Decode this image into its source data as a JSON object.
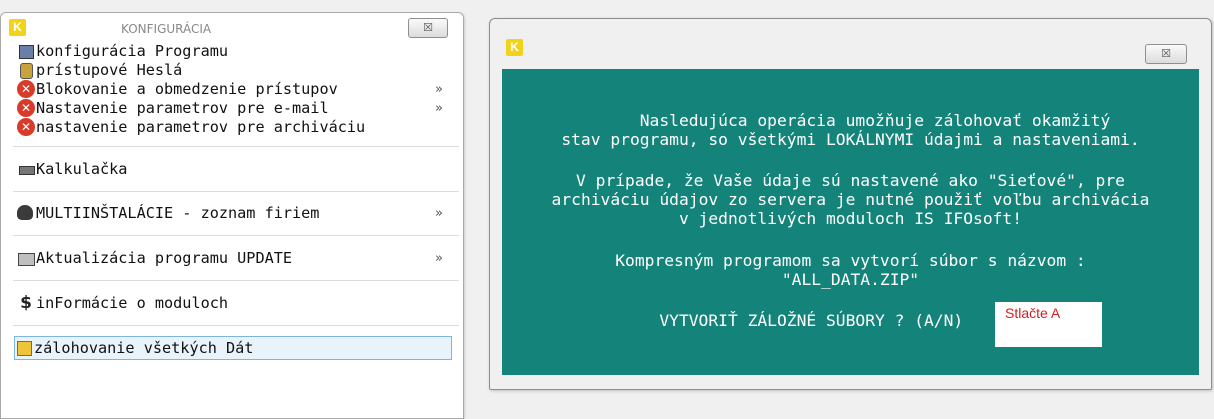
{
  "menu_window": {
    "logo": "K",
    "title": "KONFIGURÁCIA",
    "close_glyph": "☒",
    "items": [
      {
        "label": "konfigurácia Programu",
        "icon": "config-icon",
        "has_submenu": false,
        "enabled": true
      },
      {
        "label": "prístupové Heslá",
        "icon": "key-icon",
        "has_submenu": false,
        "enabled": true
      },
      {
        "label": "Blokovanie a obmedzenie prístupov",
        "icon": "disabled-x-icon",
        "has_submenu": true,
        "arrow": "»",
        "enabled": false
      },
      {
        "label": "Nastavenie parametrov pre e-mail",
        "icon": "disabled-x-icon",
        "has_submenu": true,
        "arrow": "»",
        "enabled": false
      },
      {
        "label": "nastavenie parametrov pre archiváciu",
        "icon": "disabled-x-icon",
        "has_submenu": false,
        "enabled": false
      },
      {
        "label": "Kalkulačka",
        "icon": "calculator-icon",
        "has_submenu": false,
        "enabled": true
      },
      {
        "label": "MULTIINŠTALÁCIE - zoznam firiem",
        "icon": "multi-install-icon",
        "has_submenu": true,
        "arrow": "»",
        "enabled": true
      },
      {
        "label": "Aktualizácia programu UPDATE",
        "icon": "update-icon",
        "has_submenu": true,
        "arrow": "»",
        "enabled": true
      },
      {
        "label": "inFormácie o moduloch",
        "icon": "dollar-icon",
        "has_submenu": false,
        "enabled": true
      },
      {
        "label": "zálohovanie všetkých Dát",
        "icon": "archive-icon",
        "has_submenu": false,
        "enabled": true,
        "selected": true
      }
    ]
  },
  "dialog": {
    "logo": "K",
    "close_glyph": "☒",
    "lines": [
      "     Nasledujúca operácia umožňuje zálohovať okamžitý",
      "stav programu, so všetkými LOKÁLNYMI údajmi a nastaveniami.",
      "",
      "V prípade, že Vaše údaje sú nastavené ako \"Sieťové\", pre",
      "archiváciu údajov zo servera je nutné použiť voľbu archivácia",
      "v jednotlivých moduloch IS IFOsoft!",
      "",
      "Kompresným programom sa vytvorí súbor s názvom :",
      "\"ALL_DATA.ZIP\"",
      "",
      "VYTVORIŤ ZÁLOŽNÉ SÚBORY ? (A/N)        "
    ],
    "hint": "Stlačte A"
  },
  "colors": {
    "dialog_bg": "#14837a",
    "disabled_icon": "#d93b2b",
    "hint_text": "#d22020",
    "selected_bg": "#e9f3fc"
  }
}
